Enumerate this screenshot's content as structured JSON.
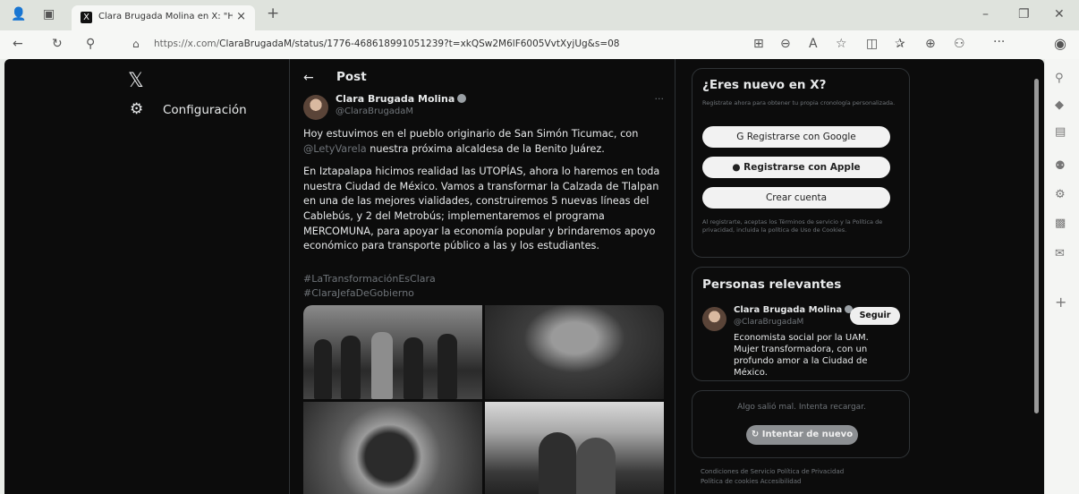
{
  "browser": {
    "tab_title": "Clara Brugada Molina en X: \"Hoy",
    "tab_close": "×",
    "new_tab": "+",
    "url_prefix": "https://x.com/",
    "url_rest": "ClaraBrugadaM/status/1776-468618991051239?t=xkQSw2M6lF6005VvtXyjUg&s=08",
    "window_minimize": "–",
    "window_restore": "❐",
    "window_close": "✕",
    "icons": [
      "profile-icon",
      "tab-actions-icon",
      "back-icon",
      "refresh-icon",
      "search-icon",
      "site-info-icon",
      "apps-icon",
      "zoom-icon",
      "read-aloud-icon",
      "favorite-icon",
      "split-screen-icon",
      "favorites-icon",
      "collections-icon",
      "extensions-icon",
      "more-icon",
      "copilot-icon"
    ]
  },
  "nav": {
    "logo": "𝕏",
    "settings_label": "Configuración"
  },
  "post": {
    "header_title": "Post",
    "author_name": "Clara Brugada Molina",
    "author_handle": "@ClaraBrugadaM",
    "more": "···",
    "p1_before": "Hoy estuvimos en el pueblo originario de San Simón Ticumac, con",
    "p1_mention": "@LetyVarela",
    "p1_after": " nuestra próxima alcaldesa de la Benito Juárez.",
    "p2": "En Iztapalapa hicimos realidad las UTOPÍAS, ahora lo haremos en toda nuestra Ciudad de México. Vamos a transformar la Calzada de Tlalpan en una de las mejores vialidades, construiremos 5 nuevas líneas del Cablebús, y 2 del Metrobús; implementaremos el programa MERCOMUNA, para apoyar la economía popular y brindaremos apoyo económico para transporte público a las y los estudiantes.",
    "hashtag_1": "#LaTransformaciónEsClara",
    "hashtag_2": "#ClaraJefaDeGobierno"
  },
  "signup": {
    "title": "¿Eres nuevo en X?",
    "subtitle": "Regístrate ahora para obtener tu propia cronología personalizada.",
    "google_button": "Registrarse con Google",
    "apple_button": "Registrarse con Apple",
    "create_account_button": "Crear cuenta",
    "terms": "Al registrarte, aceptas los Términos de servicio y la Política de privacidad, incluida la política de Uso de Cookies."
  },
  "relevant": {
    "title": "Personas relevantes",
    "name": "Clara Brugada Molina",
    "handle": "@ClaraBrugadaM",
    "follow_button": "Seguir",
    "bio": "Economista social por la UAM. Mujer transformadora, con un profundo amor a la Ciudad de México."
  },
  "error": {
    "message": "Algo salió mal. Intenta recargar.",
    "retry_button": "Intentar de nuevo"
  },
  "footer": {
    "links_line_1": "Condiciones de Servicio   Política de Privacidad",
    "links_line_2": "Política de cookies   Accesibilidad"
  }
}
